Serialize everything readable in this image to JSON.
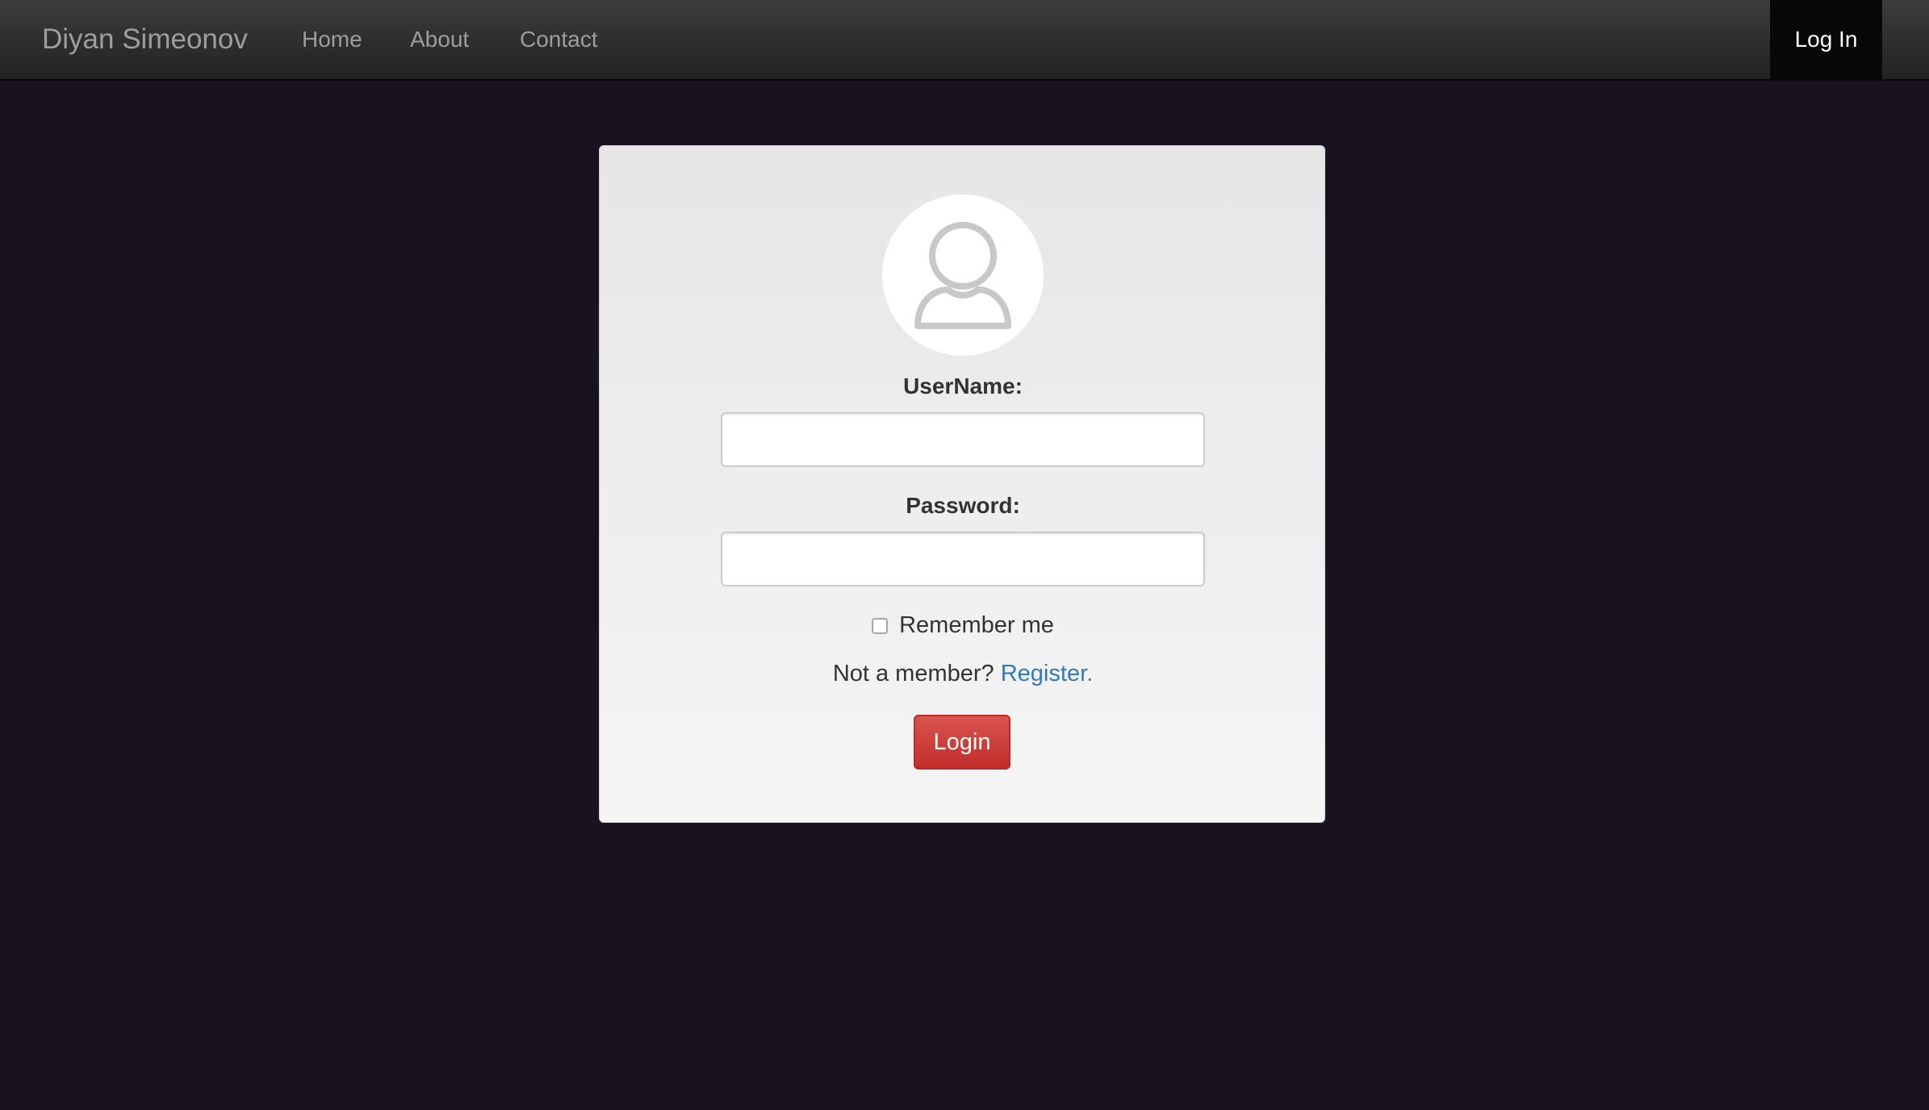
{
  "navbar": {
    "brand": "Diyan Simeonov",
    "links": [
      "Home",
      "About",
      "Contact"
    ],
    "login_label": "Log In",
    "bg_color": "#222222",
    "active_bg_color": "#080808"
  },
  "page": {
    "bg_color": "#18131f"
  },
  "login_form": {
    "avatar_icon": "user-silhouette-icon",
    "username_label": "UserName:",
    "username_value": "",
    "password_label": "Password:",
    "password_value": "",
    "remember_label": "Remember me",
    "remember_checked": false,
    "member_prompt": "Not a member?",
    "register_link": "Register.",
    "submit_label": "Login",
    "submit_color": "#d9534f",
    "link_color": "#337ab7"
  }
}
